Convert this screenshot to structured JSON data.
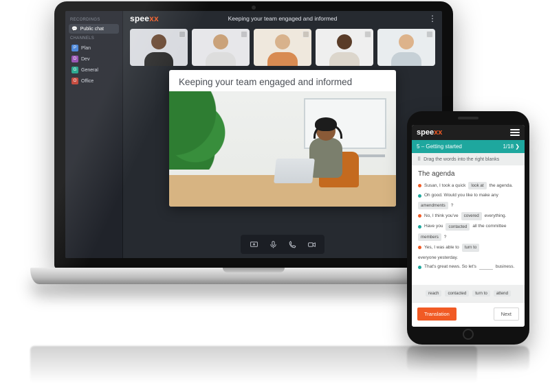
{
  "brand": {
    "name_prefix": "spee",
    "name_suffix": "xx"
  },
  "meeting": {
    "title": "Keeping your team engaged and informed",
    "sidebar": {
      "section_recordings": "RECORDINGS",
      "recent_item": "Public chat",
      "section_channels": "CHANNELS",
      "channels": [
        {
          "initial": "P",
          "label": "Plan"
        },
        {
          "initial": "D",
          "label": "Dev"
        },
        {
          "initial": "G",
          "label": "General"
        },
        {
          "initial": "O",
          "label": "Office"
        }
      ]
    },
    "presentation_title": "Keeping your team engaged and informed",
    "participants": [
      {
        "id": "participant-1"
      },
      {
        "id": "participant-2"
      },
      {
        "id": "participant-3"
      },
      {
        "id": "participant-4"
      },
      {
        "id": "participant-5"
      }
    ],
    "controls": {
      "share": "share-icon",
      "mic": "mic-icon",
      "phone": "phone-icon",
      "video": "video-icon"
    }
  },
  "mobile": {
    "lesson_number": "5",
    "lesson_sep": "–",
    "lesson_title": "Getting started",
    "progress": "1/18",
    "progress_arrow": "❯",
    "hint_icon": "drag-icon",
    "hint": "Drag the words into the right blanks",
    "heading": "The agenda",
    "lines": [
      {
        "color": "o",
        "pre": "Susan, I took a quick",
        "chip": "look at",
        "post": "the agenda."
      },
      {
        "color": "t",
        "pre": "Oh good. Would you like to make any",
        "chip": "amendments",
        "post": "?"
      },
      {
        "color": "o",
        "pre": "No, I think you've",
        "chip": "covered",
        "post": "everything."
      },
      {
        "color": "t",
        "pre": "Have you",
        "chip": "contacted",
        "mid": "all the committee",
        "chip2": "members",
        "post": "?"
      },
      {
        "color": "o",
        "pre": "Yes, I was able to",
        "chip": "turn to",
        "post": "everyone yesterday."
      },
      {
        "color": "t",
        "pre": "That's great news. So let's",
        "blank": true,
        "post": "business."
      }
    ],
    "bank": [
      "reach",
      "contacted",
      "turn to",
      "attend"
    ],
    "btn_primary": "Translation",
    "btn_secondary": "Next"
  }
}
